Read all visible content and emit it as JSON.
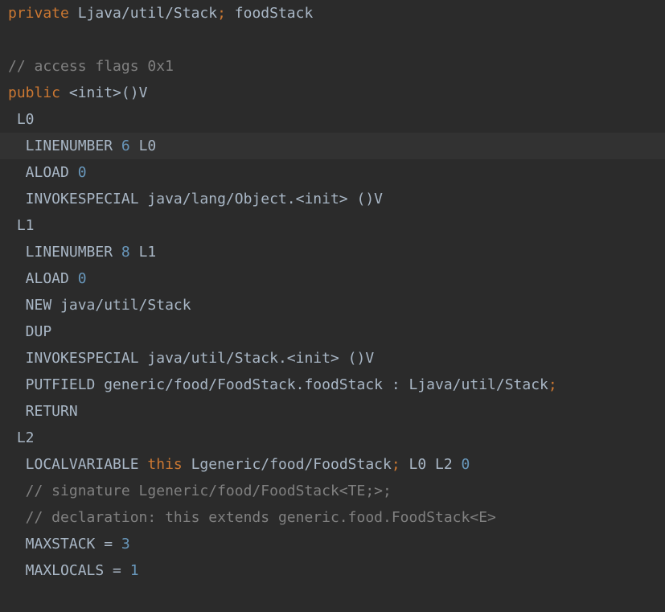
{
  "lines": [
    {
      "segments": [
        {
          "t": "private",
          "c": "kw"
        },
        {
          "t": " Ljava/util/Stack"
        },
        {
          "t": ";",
          "c": "sep"
        },
        {
          "t": " foodStack"
        }
      ]
    },
    {
      "segments": []
    },
    {
      "segments": [
        {
          "t": "// access flags 0x1",
          "c": "cmt"
        }
      ]
    },
    {
      "segments": [
        {
          "t": "public",
          "c": "kw"
        },
        {
          "t": " <init>()V"
        }
      ]
    },
    {
      "segments": [
        {
          "t": " L0"
        }
      ]
    },
    {
      "current": true,
      "segments": [
        {
          "t": "  LINENUMBER "
        },
        {
          "t": "6",
          "c": "num"
        },
        {
          "t": " L0"
        }
      ]
    },
    {
      "segments": [
        {
          "t": "  ALOAD "
        },
        {
          "t": "0",
          "c": "num"
        }
      ]
    },
    {
      "segments": [
        {
          "t": "  INVOKESPECIAL java/lang/Object.<init> ()V"
        }
      ]
    },
    {
      "segments": [
        {
          "t": " L1"
        }
      ]
    },
    {
      "segments": [
        {
          "t": "  LINENUMBER "
        },
        {
          "t": "8",
          "c": "num"
        },
        {
          "t": " L1"
        }
      ]
    },
    {
      "segments": [
        {
          "t": "  ALOAD "
        },
        {
          "t": "0",
          "c": "num"
        }
      ]
    },
    {
      "segments": [
        {
          "t": "  NEW java/util/Stack"
        }
      ]
    },
    {
      "segments": [
        {
          "t": "  DUP"
        }
      ]
    },
    {
      "segments": [
        {
          "t": "  INVOKESPECIAL java/util/Stack.<init> ()V"
        }
      ]
    },
    {
      "segments": [
        {
          "t": "  PUTFIELD generic/food/FoodStack.foodStack : Ljava/util/Stack"
        },
        {
          "t": ";",
          "c": "sep"
        }
      ]
    },
    {
      "segments": [
        {
          "t": "  RETURN"
        }
      ]
    },
    {
      "segments": [
        {
          "t": " L2"
        }
      ]
    },
    {
      "segments": [
        {
          "t": "  LOCALVARIABLE "
        },
        {
          "t": "this",
          "c": "kw"
        },
        {
          "t": " Lgeneric/food/FoodStack"
        },
        {
          "t": ";",
          "c": "sep"
        },
        {
          "t": " L0 L2 "
        },
        {
          "t": "0",
          "c": "num"
        }
      ]
    },
    {
      "segments": [
        {
          "t": "  // signature Lgeneric/food/FoodStack<TE;>;",
          "c": "cmt"
        }
      ]
    },
    {
      "segments": [
        {
          "t": "  // declaration: this extends generic.food.FoodStack<E>",
          "c": "cmt"
        }
      ]
    },
    {
      "segments": [
        {
          "t": "  MAXSTACK = "
        },
        {
          "t": "3",
          "c": "num"
        }
      ]
    },
    {
      "segments": [
        {
          "t": "  MAXLOCALS = "
        },
        {
          "t": "1",
          "c": "num"
        }
      ]
    }
  ]
}
